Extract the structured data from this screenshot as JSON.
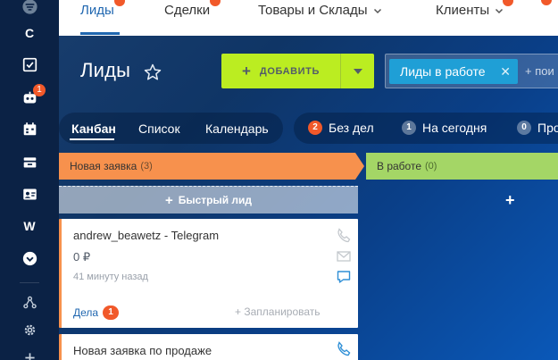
{
  "rail": {
    "letter_c": "C",
    "letter_w": "W",
    "robot_badge": "1",
    "icons": [
      "filter-icon",
      "checkbox-icon",
      "robot-icon",
      "calendar-icon",
      "storage-icon",
      "contact-card-icon",
      "chevron-circle-icon",
      "sitemap-icon",
      "gear-icon",
      "plus-icon"
    ]
  },
  "topnav": {
    "tabs": [
      {
        "label": "Лиды",
        "active": true
      },
      {
        "label": "Сделки"
      },
      {
        "label": "Товары и Склады"
      },
      {
        "label": "Клиенты"
      }
    ]
  },
  "header": {
    "title": "Лиды",
    "add_button": "ДОБАВИТЬ",
    "filter_chip": "Лиды в работе",
    "filter_search": "+ пои"
  },
  "views": {
    "items": [
      "Канбан",
      "Список",
      "Календарь"
    ]
  },
  "counters": [
    {
      "count": "2",
      "label": "Без дел",
      "color": "#f1592a"
    },
    {
      "count": "1",
      "label": "На сегодня"
    },
    {
      "count": "0",
      "label": "Про"
    }
  ],
  "kanban": {
    "columns": [
      {
        "title": "Новая заявка",
        "count": "(3)",
        "color": "#f7914d"
      },
      {
        "title": "В работе",
        "count": "(0)",
        "color": "#a4d666"
      }
    ],
    "quick_lead": "Быстрый лид",
    "cards": [
      {
        "title": "andrew_beawetz - Telegram",
        "price": "0 ₽",
        "time": "41 минуту назад",
        "deals_label": "Дела",
        "deals_count": "1",
        "plan": "+ Запланировать"
      },
      {
        "title": "Новая заявка по продаже"
      }
    ]
  }
}
